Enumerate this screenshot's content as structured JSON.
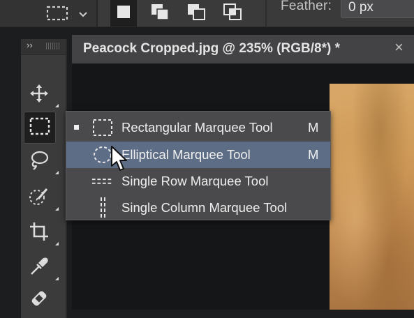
{
  "options_bar": {
    "tool_icon": "rectangular-marquee-icon",
    "tool_dropdown_icon": "chevron-down-icon",
    "selection_modes": [
      {
        "name": "new-selection",
        "icon": "new-selection-icon",
        "active": true
      },
      {
        "name": "add-to-selection",
        "icon": "add-selection-icon",
        "active": false
      },
      {
        "name": "subtract-from-selection",
        "icon": "subtract-selection-icon",
        "active": false
      },
      {
        "name": "intersect-with-selection",
        "icon": "intersect-selection-icon",
        "active": false
      }
    ],
    "feather_label": "Feather:",
    "feather_value": "0 px"
  },
  "toolbar": {
    "collapse_label": "››",
    "tools": [
      {
        "name": "move-tool",
        "icon": "move-icon",
        "selected": false
      },
      {
        "name": "marquee-tool",
        "icon": "rectangular-marquee-icon",
        "selected": true
      },
      {
        "name": "lasso-tool",
        "icon": "lasso-icon",
        "selected": false
      },
      {
        "name": "quick-selection-tool",
        "icon": "quick-selection-icon",
        "selected": false
      },
      {
        "name": "crop-tool",
        "icon": "crop-icon",
        "selected": false
      },
      {
        "name": "eyedropper-tool",
        "icon": "eyedropper-icon",
        "selected": false
      },
      {
        "name": "healing-brush-tool",
        "icon": "bandage-icon",
        "selected": false
      }
    ]
  },
  "document": {
    "tab_title": "Peacock Cropped.jpg @ 235% (RGB/8*) *",
    "close_label": "×"
  },
  "marquee_menu": {
    "items": [
      {
        "label": "Rectangular Marquee Tool",
        "shortcut": "M",
        "icon": "rectangular-marquee-icon",
        "current": true,
        "hover": false
      },
      {
        "label": "Elliptical Marquee Tool",
        "shortcut": "M",
        "icon": "elliptical-marquee-icon",
        "current": false,
        "hover": true
      },
      {
        "label": "Single Row Marquee Tool",
        "shortcut": "",
        "icon": "single-row-marquee-icon",
        "current": false,
        "hover": false
      },
      {
        "label": "Single Column Marquee Tool",
        "shortcut": "",
        "icon": "single-column-marquee-icon",
        "current": false,
        "hover": false
      }
    ]
  },
  "colors": {
    "hover_highlight": "#5e6d86",
    "menu_bg": "#4a4a4c",
    "panel_bg": "#3b3b3c"
  }
}
